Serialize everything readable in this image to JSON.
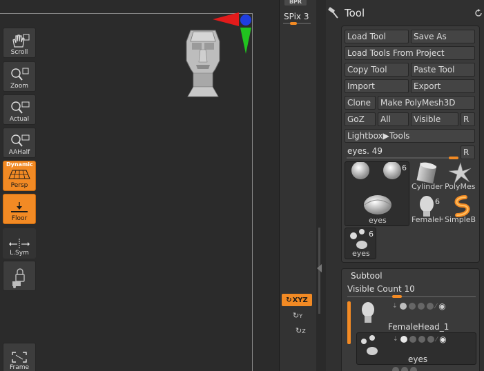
{
  "shelf": {
    "bpr_label": "BPR",
    "spix_label": "SPix",
    "spix_value": "3",
    "buttons": {
      "scroll": "Scroll",
      "zoom": "Zoom",
      "actual": "Actual",
      "aahalf": "AAHalf",
      "persp_badge": "Dynamic",
      "persp": "Persp",
      "floor": "Floor",
      "lsym": "L.Sym",
      "xyz": "XYZ",
      "frame": "Frame"
    },
    "axis_y": "Y",
    "axis_z": "Z",
    "accent": "#f28a24"
  },
  "tool": {
    "title": "Tool",
    "load_tool": "Load Tool",
    "save_as": "Save As",
    "load_from_project": "Load Tools From Project",
    "copy_tool": "Copy Tool",
    "paste_tool": "Paste Tool",
    "import": "Import",
    "export": "Export",
    "clone": "Clone",
    "make_polymesh": "Make PolyMesh3D",
    "goz": "GoZ",
    "all": "All",
    "visible": "Visible",
    "r": "R",
    "lightbox_tools": "Lightbox▶Tools",
    "slider_label": "eyes. 49",
    "slider_r": "R",
    "thumbs": {
      "main_label": "eyes",
      "main_count": "6",
      "cylinder": "Cylinder",
      "polymesh": "PolyMes",
      "femalehead": "FemaleH",
      "femalehead_count": "6",
      "simpleb": "SimpleB",
      "small_label": "eyes",
      "small_count": "6"
    }
  },
  "subtool": {
    "title": "Subtool",
    "visible_count_label": "Visible Count",
    "visible_count_value": "10",
    "rows": [
      {
        "name": "FemaleHead_1"
      },
      {
        "name": "eyes"
      }
    ]
  }
}
